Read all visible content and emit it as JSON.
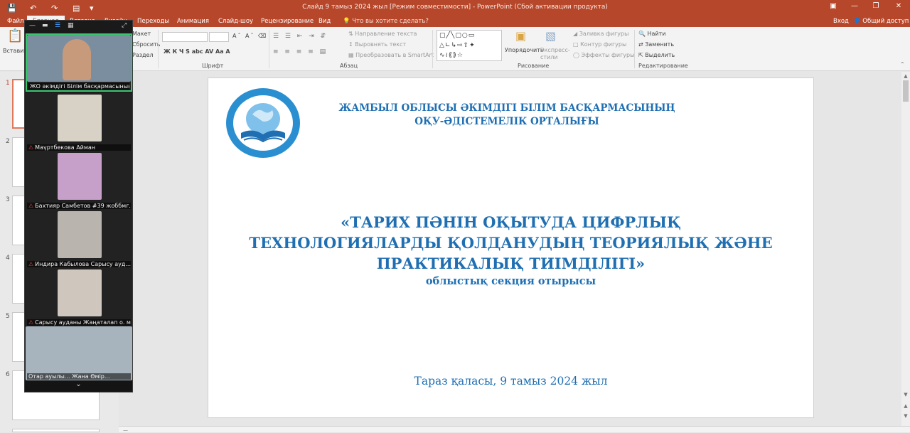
{
  "window": {
    "title": "Слайд 9 тамыз 2024 жыл [Режим совместимости] - PowerPoint (Сбой активации продукта)",
    "login": "Вход",
    "share": "Общий доступ"
  },
  "tabs": [
    {
      "label": "Файл"
    },
    {
      "label": "Главная"
    },
    {
      "label": "Вставка"
    },
    {
      "label": "Дизайн"
    },
    {
      "label": "Переходы"
    },
    {
      "label": "Анимация"
    },
    {
      "label": "Слайд-шоу"
    },
    {
      "label": "Рецензирование"
    },
    {
      "label": "Вид"
    }
  ],
  "tellme": "Что вы хотите сделать?",
  "ribbon": {
    "paste": "Вставить",
    "layout": "Макет",
    "reset": "Сбросить",
    "section": "Раздел",
    "font_group": "Шрифт",
    "font_format": "Ж  К  Ч  S  abc  AV  Aa  A",
    "paragraph_group": "Абзац",
    "text_direction": "Направление текста",
    "align_text": "Выровнять текст",
    "smartart": "Преобразовать в SmartArt",
    "drawing_group": "Рисование",
    "arrange": "Упорядочить",
    "quick_styles": "Экспресс-стили",
    "shape_fill": "Заливка фигуры",
    "shape_outline": "Контур фигуры",
    "shape_effects": "Эффекты фигуры",
    "editing_group": "Редактирование",
    "find": "Найти",
    "replace": "Заменить",
    "select": "Выделить"
  },
  "thumbnails": [
    "1",
    "2",
    "3",
    "4",
    "5",
    "6"
  ],
  "slide": {
    "org_line1": "ЖАМБЫЛ ОБЛЫСЫ ӘКІМДІГІ БІЛІМ БАСҚАРМАСЫНЫҢ",
    "org_line2": "ОҚУ-ӘДІСТЕМЕЛІК ОРТАЛЫҒЫ",
    "title_line1": "«ТАРИХ ПӘНІН ОҚЫТУДА ЦИФРЛЫҚ",
    "title_line2": "ТЕХНОЛОГИЯЛАРДЫ ҚОЛДАНУДЫҢ ТЕОРИЯЛЫҚ ЖӘНЕ",
    "title_line3": "ПРАКТИКАЛЫҚ ТИІМДІЛІГІ»",
    "subtitle": "облыстық секция отырысы",
    "place_date": "Тараз қаласы, 9 тамыз 2024 жыл",
    "text_color": "#1f6fb2"
  },
  "call": {
    "participants": [
      {
        "name": "ЖО әкімдігі Білім басқармасынын..."
      },
      {
        "name": "Маүртбекова Айман"
      },
      {
        "name": "Бахтияр Самбетов #39 жоббмг..."
      },
      {
        "name": "Индира Кабылова Сарысу ауд..."
      },
      {
        "name": "Сарысу ауданы Жаңаталап о. м..."
      },
      {
        "name": "Отар ауылы... Жана Өмір..."
      }
    ],
    "active_color": "#39c56e"
  }
}
